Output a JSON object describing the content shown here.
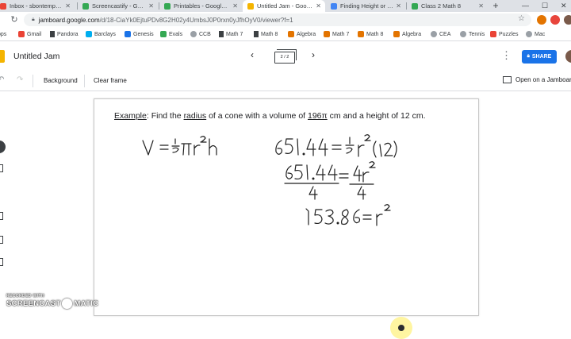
{
  "browser": {
    "tabs": [
      {
        "label": "Inbox - sbontempo@ci",
        "color": "#ea4335",
        "active": false
      },
      {
        "label": "Screencastify - Google",
        "color": "#34a853",
        "active": false
      },
      {
        "label": "Printables - Google Dri",
        "color": "#34a853",
        "active": false
      },
      {
        "label": "Untitled Jam - Google",
        "color": "#f4b400",
        "active": true
      },
      {
        "label": "Finding Height or Radi",
        "color": "#4285f4",
        "active": false
      },
      {
        "label": "Class 2 Math 8",
        "color": "#34a853",
        "active": false
      }
    ],
    "new_tab": "+",
    "url_domain": "jamboard.google.com",
    "url_path": "/d/18-CiaYk0EjtuPDv8G2H02y4UmbsJ0P0rxn0yJfhOyV0/viewer?f=1",
    "bookmarks": [
      {
        "label": "pps",
        "icon": "apps-icon",
        "color": "#5f6368"
      },
      {
        "label": "Gmail",
        "icon": "gmail-icon",
        "color": "#ea4335"
      },
      {
        "label": "Pandora",
        "icon": "bookmark-icon",
        "color": "#3c4043"
      },
      {
        "label": "Barclays",
        "icon": "barclays-icon",
        "color": "#00aeef"
      },
      {
        "label": "Genesis",
        "icon": "genesis-icon",
        "color": "#1a73e8"
      },
      {
        "label": "Evals",
        "icon": "evals-icon",
        "color": "#34a853"
      },
      {
        "label": "CCB",
        "icon": "globe-icon",
        "color": "#9aa0a6"
      },
      {
        "label": "Math 7",
        "icon": "bookmark-icon",
        "color": "#3c4043"
      },
      {
        "label": "Math 8",
        "icon": "bookmark-icon",
        "color": "#3c4043"
      },
      {
        "label": "Algebra",
        "icon": "algebra-icon",
        "color": "#e37400"
      },
      {
        "label": "Math 7",
        "icon": "math7-icon",
        "color": "#e37400"
      },
      {
        "label": "Math 8",
        "icon": "math8-icon",
        "color": "#e37400"
      },
      {
        "label": "Algebra",
        "icon": "algebra-icon",
        "color": "#e37400"
      },
      {
        "label": "CEA",
        "icon": "globe-icon",
        "color": "#9aa0a6"
      },
      {
        "label": "Tennis",
        "icon": "globe-icon",
        "color": "#9aa0a6"
      },
      {
        "label": "Puzzles",
        "icon": "puzzles-icon",
        "color": "#ea4335"
      },
      {
        "label": "Mac",
        "icon": "globe-icon",
        "color": "#9aa0a6"
      }
    ]
  },
  "jam": {
    "title": "Untitled Jam",
    "frame_indicator": "2 / 2",
    "share_label": "SHARE",
    "toolbar": {
      "background_label": "Background",
      "clear_label": "Clear frame",
      "open_label": "Open on a Jamboard"
    }
  },
  "board": {
    "prompt_pre": "",
    "prompt_example": "Example",
    "prompt_mid1": ": Find the ",
    "prompt_radius": "radius",
    "prompt_mid2": " of a cone with a volume of ",
    "prompt_volume": "196π",
    "prompt_end": " cm and a height of 12 cm."
  },
  "watermark": {
    "top": "RECORDED WITH",
    "left": "SCREENCAST",
    "right": "MATIC"
  }
}
